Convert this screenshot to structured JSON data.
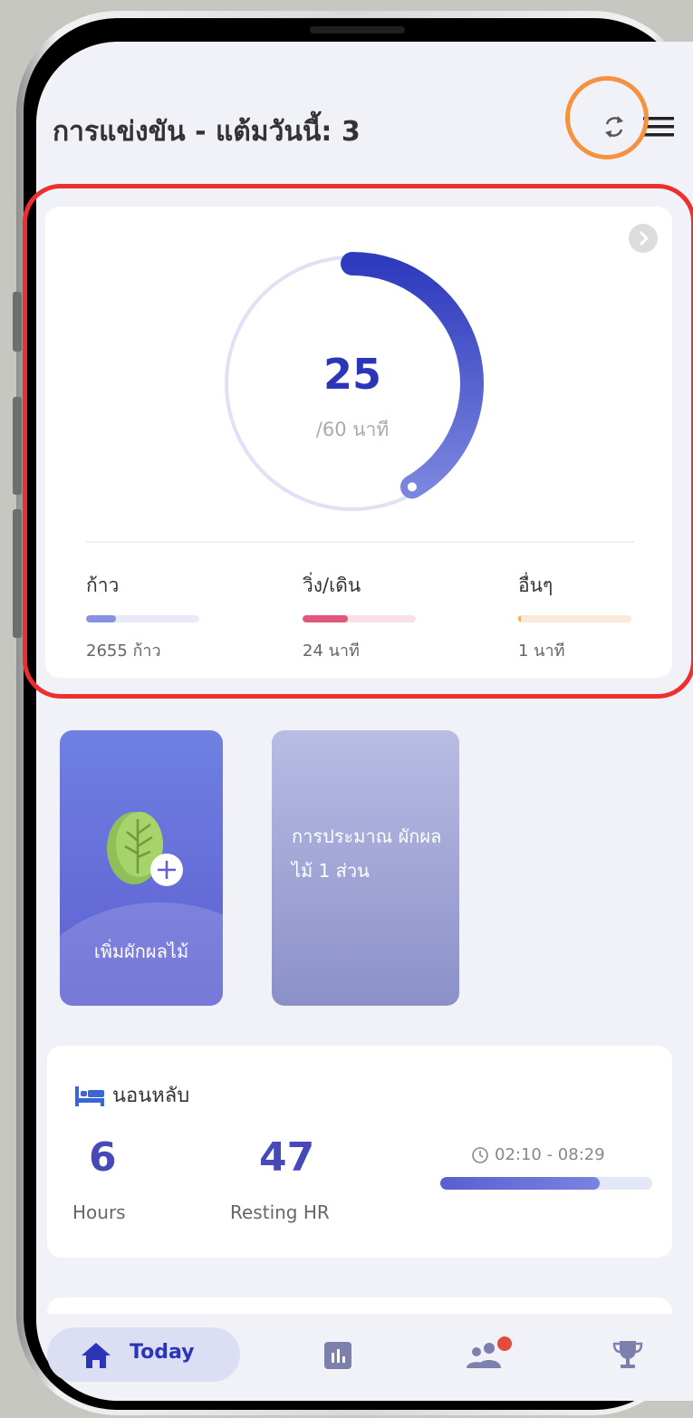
{
  "header": {
    "title": "การแข่งขัน - แต้มวันนี้: 3"
  },
  "activity": {
    "value": "25",
    "goal_text": "/60 นาที",
    "progress": 0.4167,
    "metrics": [
      {
        "label": "ก้าว",
        "value": "2655 ก้าว",
        "fill": 0.26,
        "color": "#8a91e3",
        "track": "#e8eaf8"
      },
      {
        "label": "วิ่ง/เดิน",
        "value": "24 นาที",
        "fill": 0.4,
        "color": "#e0577a",
        "track": "#f7e1e6"
      },
      {
        "label": "อื่นๆ",
        "value": "1 นาที",
        "fill": 0.02,
        "color": "#f0b24a",
        "track": "#fbeadb"
      }
    ]
  },
  "cards": {
    "add_veg_label": "เพิ่มผักผลไม้",
    "estimate_text": "การประมาณ ผักผลไม้ 1 ส่วน"
  },
  "sleep": {
    "title": "นอนหลับ",
    "hours": "6",
    "hours_label": "Hours",
    "resting_hr": "47",
    "resting_hr_label": "Resting HR",
    "time_range": "02:10 - 08:29",
    "bar_fill": 0.75
  },
  "nav": {
    "today_label": "Today",
    "items": [
      "home-icon",
      "stats-icon",
      "group-icon",
      "trophy-icon"
    ]
  },
  "colors": {
    "accent": "#2a35b8",
    "ring_track": "#dfe1f6",
    "highlight_red": "#ee2f2f",
    "highlight_orange": "#f6923f",
    "notification": "#e34b3a"
  }
}
